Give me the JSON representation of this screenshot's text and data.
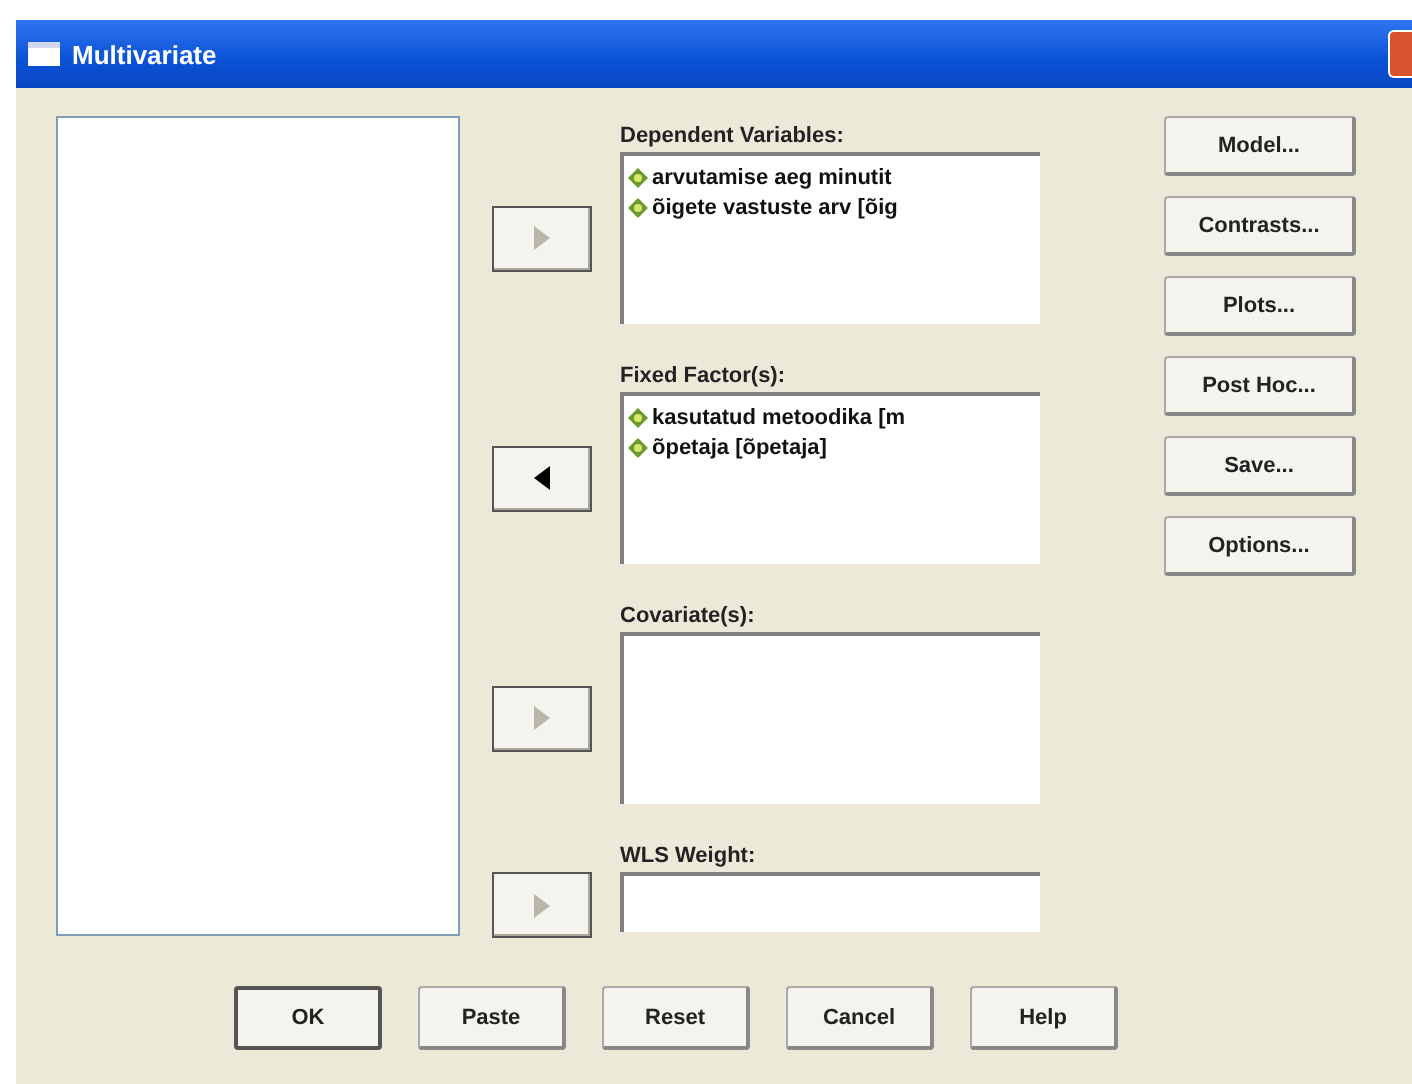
{
  "window": {
    "title": "Multivariate"
  },
  "groups": [
    {
      "label": "Dependent Variables:",
      "kind": "list",
      "arrow": {
        "kind": "right",
        "disabled": true
      },
      "items": [
        "arvutamise aeg minutit",
        "õigete vastuste arv [õig"
      ]
    },
    {
      "label": "Fixed Factor(s):",
      "kind": "list",
      "arrow": {
        "kind": "left",
        "disabled": false
      },
      "items": [
        "kasutatud metoodika [m",
        "õpetaja [õpetaja]"
      ]
    },
    {
      "label": "Covariate(s):",
      "kind": "list",
      "arrow": {
        "kind": "right",
        "disabled": true
      }
    },
    {
      "label": "WLS Weight:",
      "kind": "field",
      "arrow": {
        "kind": "right",
        "disabled": true
      }
    }
  ],
  "side_buttons": [
    "Model...",
    "Contrasts...",
    "Plots...",
    "Post Hoc...",
    "Save...",
    "Options..."
  ],
  "bottom_buttons": [
    {
      "label": "OK",
      "default": true
    },
    {
      "label": "Paste",
      "default": false
    },
    {
      "label": "Reset",
      "default": false
    },
    {
      "label": "Cancel",
      "default": false
    },
    {
      "label": "Help",
      "default": false
    }
  ]
}
